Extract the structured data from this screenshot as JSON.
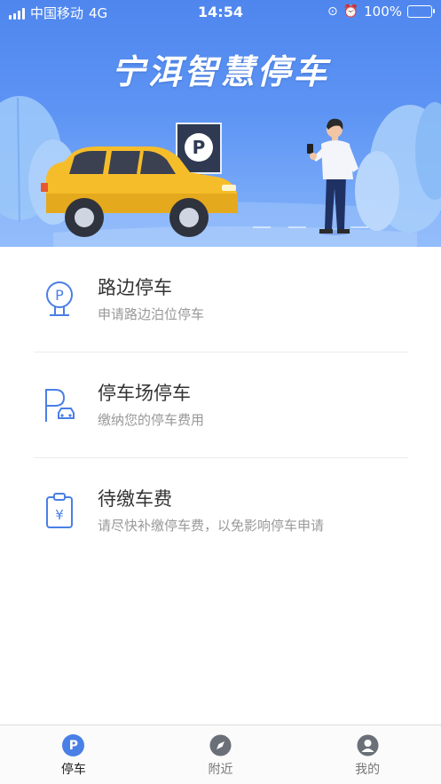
{
  "status_bar": {
    "carrier": "中国移动",
    "network": "4G",
    "time": "14:54",
    "battery": "100%",
    "battery_color": "#4cd964"
  },
  "hero": {
    "title": "宁洱智慧停车",
    "sign_letter": "P",
    "colors": {
      "top": "#4f86ee",
      "bottom": "#86b4fa",
      "car": "#f6bd2b"
    }
  },
  "menu": [
    {
      "title": "路边停车",
      "desc": "申请路边泊位停车",
      "icon": "roadside-parking-icon"
    },
    {
      "title": "停车场停车",
      "desc": "缴纳您的停车费用",
      "icon": "parking-lot-icon"
    },
    {
      "title": "待缴车费",
      "desc": "请尽快补缴停车费，以免影响停车申请",
      "icon": "pending-fee-icon"
    }
  ],
  "tabs": [
    {
      "label": "停车",
      "icon": "parking-tab-icon",
      "glyph": "P",
      "active": true
    },
    {
      "label": "附近",
      "icon": "compass-icon",
      "active": false
    },
    {
      "label": "我的",
      "icon": "user-icon",
      "active": false
    }
  ],
  "accent_color": "#4a7fe6"
}
